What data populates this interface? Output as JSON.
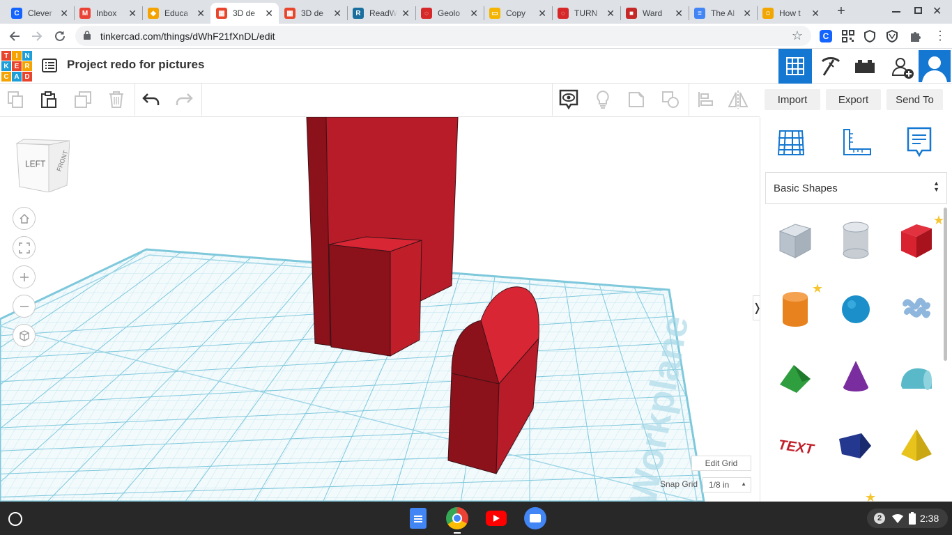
{
  "browser": {
    "tabs": [
      {
        "title": "Clever",
        "icon": "clever-icon",
        "color": "#1464ff",
        "glyph": "C"
      },
      {
        "title": "Inbox",
        "icon": "gmail-icon",
        "color": "#ea4335",
        "glyph": "M"
      },
      {
        "title": "Educa",
        "icon": "education-icon",
        "color": "#f4a300",
        "glyph": "◆"
      },
      {
        "title": "3D de",
        "icon": "tinkercad-icon",
        "color": "#e8452c",
        "glyph": "▦",
        "active": true
      },
      {
        "title": "3D de",
        "icon": "tinkercad-icon",
        "color": "#e8452c",
        "glyph": "▦"
      },
      {
        "title": "ReadW",
        "icon": "readworks-icon",
        "color": "#1a6f9e",
        "glyph": "R"
      },
      {
        "title": "Geolo",
        "icon": "turnitin-icon",
        "color": "#d62828",
        "glyph": "◌"
      },
      {
        "title": "Copy",
        "icon": "slides-icon",
        "color": "#f4b400",
        "glyph": "▭"
      },
      {
        "title": "TURN",
        "icon": "turnitin-icon",
        "color": "#d62828",
        "glyph": "◌"
      },
      {
        "title": "Ward",
        "icon": "ward-icon",
        "color": "#c62828",
        "glyph": "■"
      },
      {
        "title": "The Al",
        "icon": "docs-icon",
        "color": "#4285f4",
        "glyph": "≡"
      },
      {
        "title": "How t",
        "icon": "how-to-icon",
        "color": "#f2a600",
        "glyph": "☺"
      }
    ],
    "url": "tinkercad.com/things/dWhF21fXnDL/edit"
  },
  "tinkercad": {
    "logo_letters": [
      "T",
      "I",
      "N",
      "K",
      "E",
      "R",
      "C",
      "A",
      "D"
    ],
    "project_title": "Project redo for pictures",
    "actions": {
      "import": "Import",
      "export": "Export",
      "send_to": "Send To"
    },
    "viewcube": {
      "left": "LEFT",
      "front": "FRONT"
    },
    "workplane_label": "Workplane",
    "edit_grid": "Edit Grid",
    "snap_grid_label": "Snap Grid",
    "snap_grid_value": "1/8 in",
    "shape_library": "Basic Shapes",
    "shapes": [
      {
        "name": "box-hole",
        "color": "#b8c2cc"
      },
      {
        "name": "cylinder-hole",
        "color": "#c7cdd3"
      },
      {
        "name": "box",
        "color": "#d8222f",
        "favorite": true
      },
      {
        "name": "cylinder",
        "color": "#e8821e",
        "favorite": true
      },
      {
        "name": "sphere",
        "color": "#1b8fc9"
      },
      {
        "name": "scribble",
        "color": "#8fb6dc"
      },
      {
        "name": "roof",
        "color": "#2e9e3e"
      },
      {
        "name": "cone",
        "color": "#7a2d9e"
      },
      {
        "name": "round-roof",
        "color": "#5ab9c9"
      },
      {
        "name": "text",
        "color": "#c01f2a"
      },
      {
        "name": "polygon",
        "color": "#23388e"
      },
      {
        "name": "pyramid",
        "color": "#e8c31c"
      }
    ]
  },
  "taskbar": {
    "notification_count": "2",
    "time": "2:38"
  },
  "colors": {
    "accent": "#1477d1",
    "shape_red": "#b71c28",
    "shape_dark": "#8b111a",
    "grid": "#7ec8dc"
  }
}
